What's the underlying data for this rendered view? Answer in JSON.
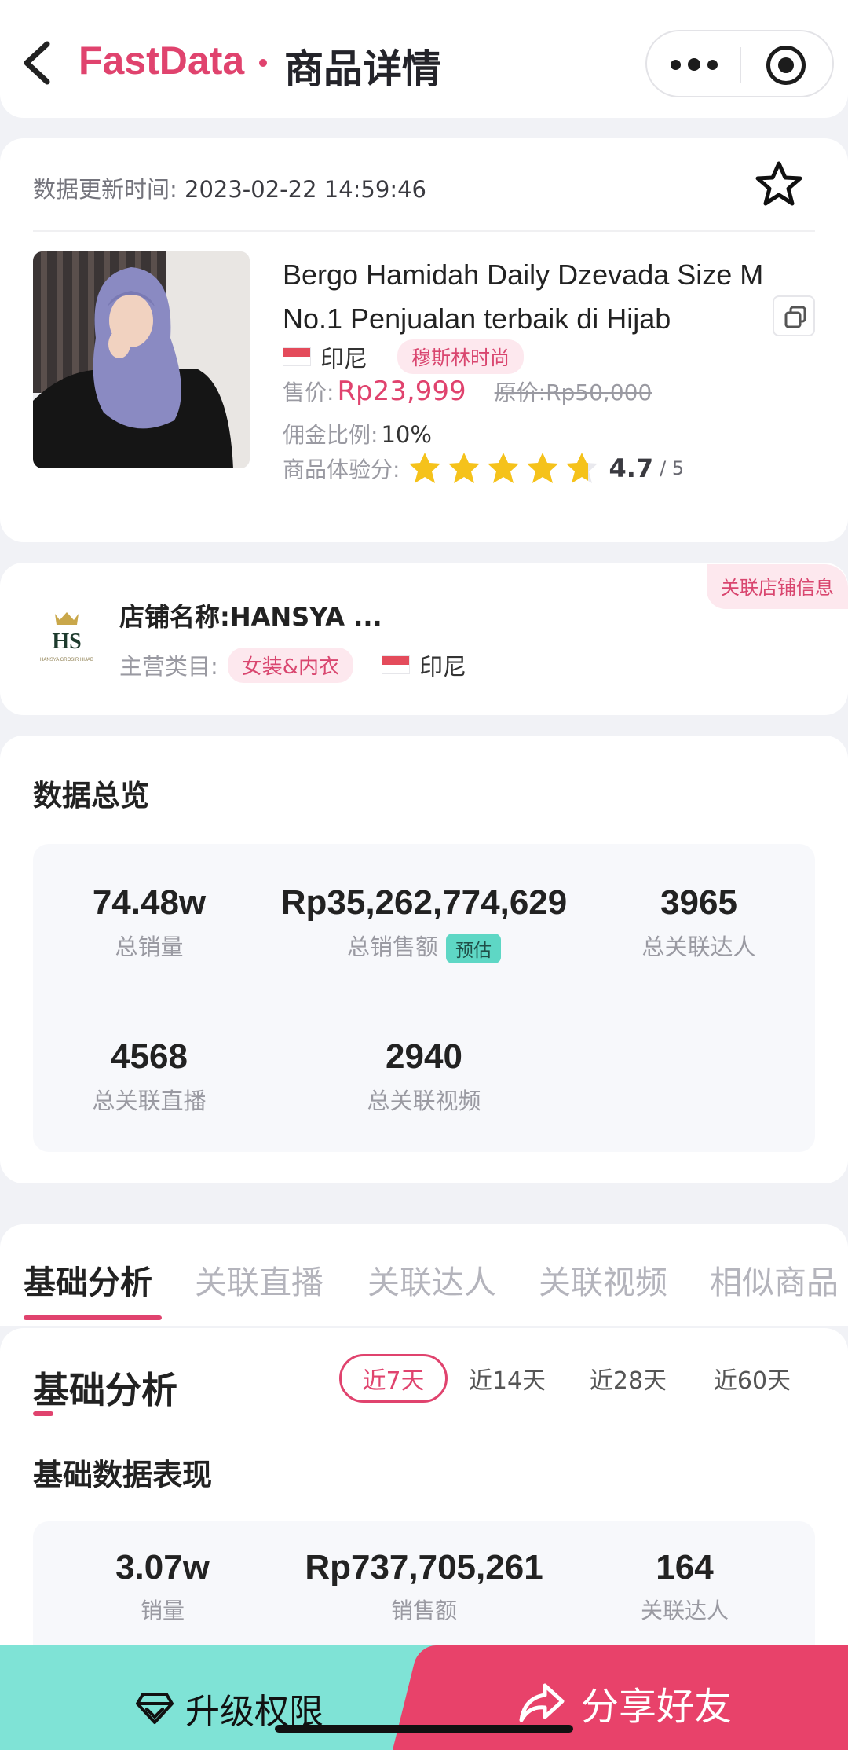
{
  "header": {
    "app_name": "FastData",
    "separator": "·",
    "page_title": "商品详情"
  },
  "product": {
    "update_label": "数据更新时间:",
    "update_time": "2023-02-22 14:59:46",
    "name": "Bergo Hamidah Daily Dzevada Size M No.1 Penjualan terbaik di Hijab",
    "country": "印尼",
    "category_tag": "穆斯林时尚",
    "price_label": "售价:",
    "price": "Rp23,999",
    "original_label": "原价:",
    "original_price": "Rp50,000",
    "commission_label": "佣金比例:",
    "commission": "10%",
    "rating_label": "商品体验分:",
    "rating": "4.7",
    "rating_max": "/ 5",
    "rating_value": 4.7
  },
  "shop": {
    "link_tag": "关联店铺信息",
    "name_label": "店铺名称:",
    "name": "HANSYA ...",
    "category_label": "主营类目:",
    "category": "女装&内衣",
    "country": "印尼",
    "logo_text": "HS",
    "logo_subtext": "HANSYA GROSIR HIJAB"
  },
  "overview": {
    "title": "数据总览",
    "stats": [
      {
        "value": "74.48w",
        "label": "总销量"
      },
      {
        "value": "Rp35,262,774,629",
        "label": "总销售额",
        "badge": "预估"
      },
      {
        "value": "3965",
        "label": "总关联达人"
      },
      {
        "value": "4568",
        "label": "总关联直播"
      },
      {
        "value": "2940",
        "label": "总关联视频"
      }
    ]
  },
  "tabs": [
    "基础分析",
    "关联直播",
    "关联达人",
    "关联视频",
    "相似商品"
  ],
  "basic": {
    "title": "基础分析",
    "ranges": [
      "近7天",
      "近14天",
      "近28天",
      "近60天"
    ],
    "subtitle": "基础数据表现",
    "stats": [
      {
        "value": "3.07w",
        "label": "销量"
      },
      {
        "value": "Rp737,705,261",
        "label": "销售额"
      },
      {
        "value": "164",
        "label": "关联达人"
      }
    ]
  },
  "bottom_bar": {
    "upgrade": "升级权限",
    "share": "分享好友"
  },
  "colors": {
    "accent": "#e0436e",
    "teal": "#7fe3d6",
    "star": "#f5c21b"
  },
  "icons": [
    "back-icon",
    "more-icon",
    "target-icon",
    "star-outline-icon",
    "copy-icon",
    "flag-icon",
    "star-icon",
    "diamond-icon",
    "share-icon"
  ]
}
